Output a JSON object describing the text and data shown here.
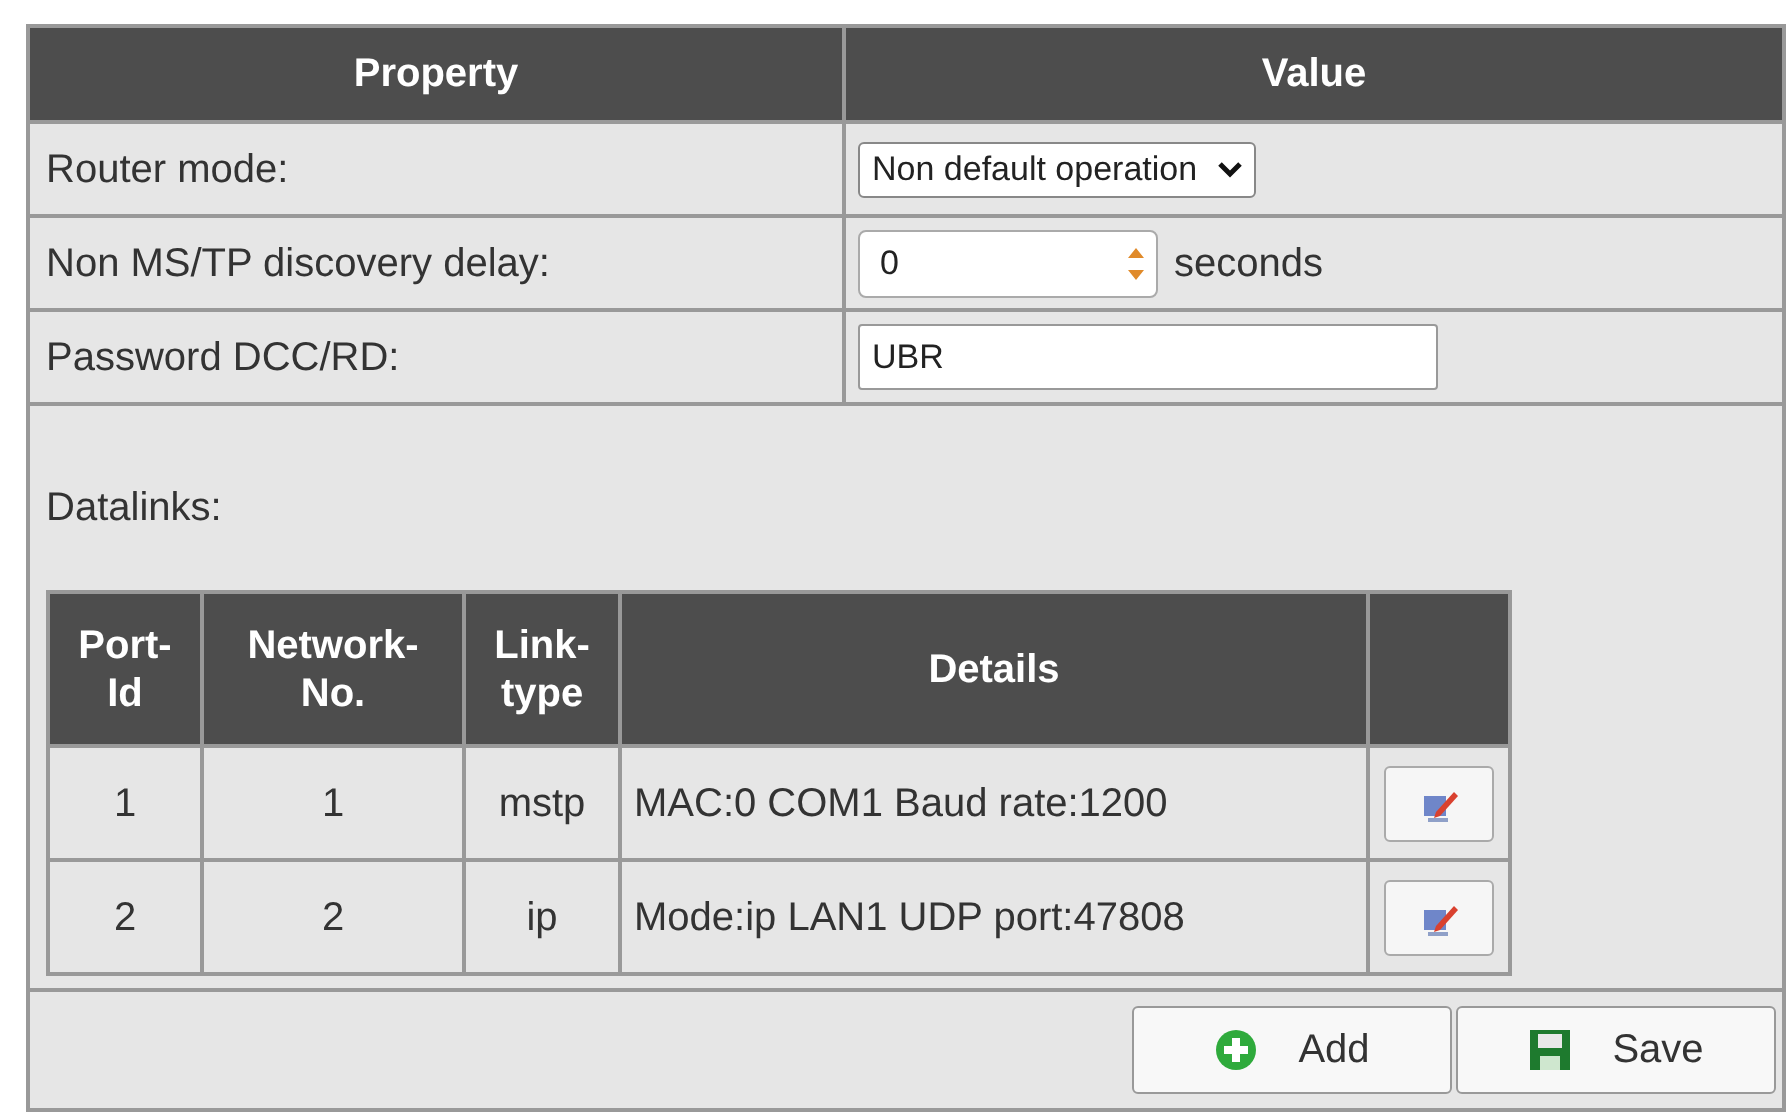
{
  "table": {
    "columns": [
      "Property",
      "Value"
    ],
    "rows": [
      {
        "kind": "select",
        "label": "Router mode:",
        "value": "Non default operation"
      },
      {
        "kind": "number",
        "label": "Non MS/TP discovery delay:",
        "value": "0",
        "unit": "seconds"
      },
      {
        "kind": "text",
        "label": "Password DCC/RD:",
        "value": "UBR"
      }
    ]
  },
  "datalinks": {
    "label": "Datalinks:",
    "columns": [
      "Port-Id",
      "Network-No.",
      "Link-type",
      "Details"
    ],
    "rows": [
      [
        "1",
        "1",
        "mstp",
        "MAC:0 COM1 Baud rate:1200"
      ],
      [
        "2",
        "2",
        "ip",
        "Mode:ip LAN1 UDP port:47808"
      ]
    ]
  },
  "buttons": [
    {
      "kind": "add",
      "label": "Add"
    },
    {
      "kind": "save",
      "label": "Save"
    }
  ]
}
